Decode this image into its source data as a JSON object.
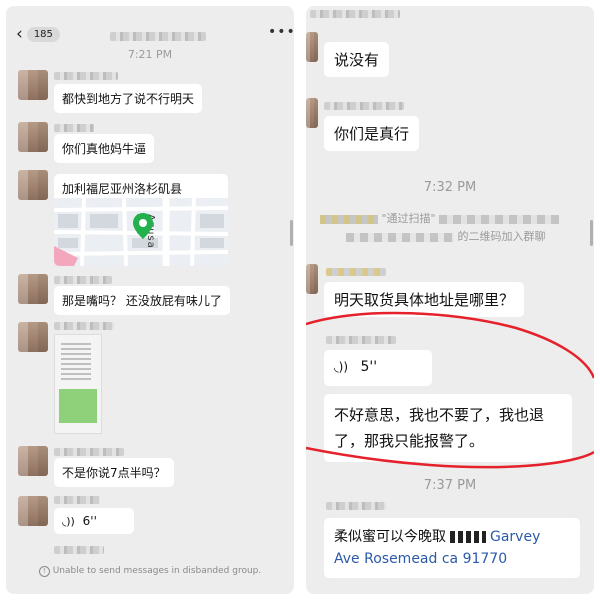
{
  "left": {
    "header": {
      "back_count": "185",
      "more_icon": "ellipsis-icon",
      "back_icon": "chevron-left-icon"
    },
    "timestamp": "7:21 PM",
    "messages": [
      "都快到地方了说不行明天",
      "你们真他妈牛逼",
      "加利福尼亚州洛杉矶县",
      "那是嘴吗？ 还没放屁有味儿了",
      "不是你说7点半吗？"
    ],
    "map": {
      "street_label": "Azusa Ave",
      "pin_color": "#22b14c"
    },
    "voice_duration": "6''",
    "footer_notice": "Unable to send messages in disbanded group."
  },
  "right": {
    "messages_top": [
      "说没有",
      "你们是真行"
    ],
    "timestamp_1": "7:32 PM",
    "system_text_1": "\"通过扫描\"",
    "system_text_2": "的二维码加入群聊",
    "msg_address_q": "明天取货具体地址是哪里？",
    "voice_duration": "5''",
    "msg_long_line1": "不好意思，我也不要了，我也退",
    "msg_long_line2": "了，那我只能报警了。",
    "timestamp_2": "7:37 PM",
    "last_line1": "柔似蜜可以今晚取",
    "last_line1_end": "Garvey",
    "last_line2": "Ave Rosemead  ca 91770",
    "annotation_color": "#e5212b"
  }
}
